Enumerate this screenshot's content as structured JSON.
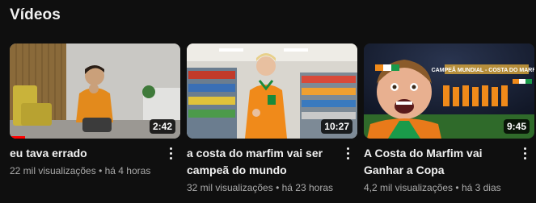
{
  "section": {
    "title": "Vídeos"
  },
  "videos": [
    {
      "title": "eu tava errado",
      "views": "22 mil visualizações",
      "separator": "•",
      "age": "há 4 horas",
      "duration": "2:42",
      "watched_progress_fraction": 0.09
    },
    {
      "title": "a costa do marfim vai ser campeã do mundo",
      "views": "32 mil visualizações",
      "separator": "•",
      "age": "há 23 horas",
      "duration": "10:27"
    },
    {
      "title": "A Costa do Marfim vai Ganhar a Copa",
      "views": "4,2 mil visualizações",
      "separator": "•",
      "age": "há 3 dias",
      "duration": "9:45",
      "thumbnail_banner": "CAMPEÃ MUNDIAL - COSTA DO MARFIM"
    }
  ],
  "icons": {
    "more": "more-vert-icon"
  },
  "colors": {
    "background": "#0f0f0f",
    "text_primary": "#f1f1f1",
    "text_secondary": "#aaaaaa",
    "progress": "#ff0000"
  }
}
